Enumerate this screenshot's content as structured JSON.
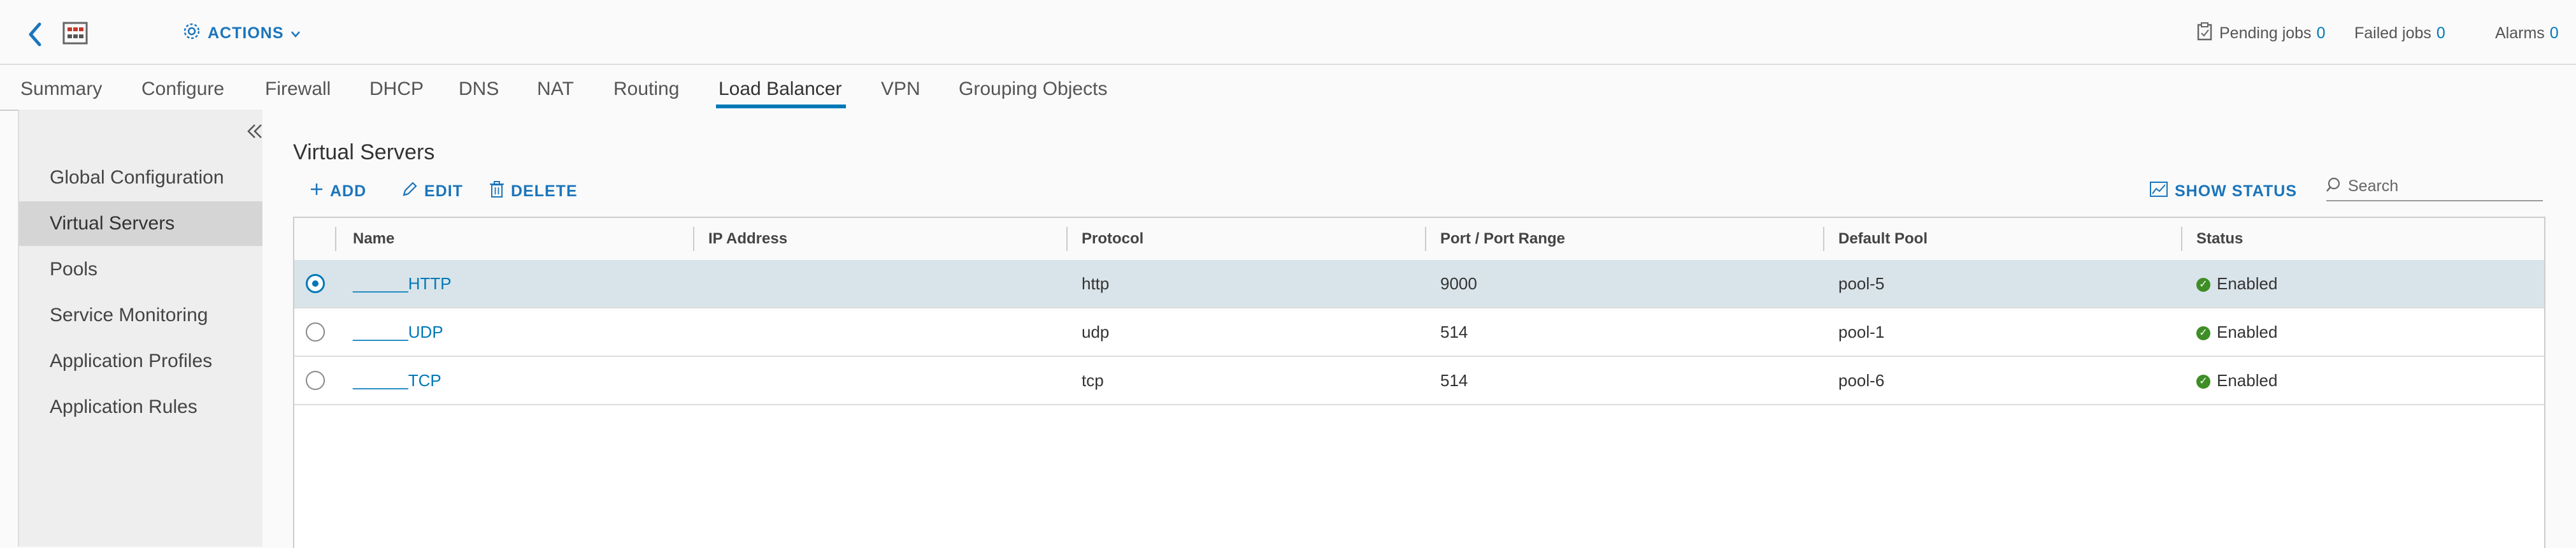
{
  "header": {
    "actions_label": "ACTIONS",
    "pending_jobs_label": "Pending jobs",
    "pending_jobs_count": "0",
    "failed_jobs_label": "Failed jobs",
    "failed_jobs_count": "0",
    "alarms_label": "Alarms",
    "alarms_count": "0"
  },
  "tabs": [
    {
      "label": "Summary"
    },
    {
      "label": "Configure"
    },
    {
      "label": "Firewall"
    },
    {
      "label": "DHCP"
    },
    {
      "label": "DNS"
    },
    {
      "label": "NAT"
    },
    {
      "label": "Routing"
    },
    {
      "label": "Load Balancer",
      "active": true
    },
    {
      "label": "VPN"
    },
    {
      "label": "Grouping Objects"
    }
  ],
  "sidebar": {
    "items": [
      {
        "label": "Global Configuration"
      },
      {
        "label": "Virtual Servers",
        "active": true
      },
      {
        "label": "Pools"
      },
      {
        "label": "Service Monitoring"
      },
      {
        "label": "Application Profiles"
      },
      {
        "label": "Application Rules"
      }
    ]
  },
  "main": {
    "title": "Virtual Servers",
    "toolbar": {
      "add_label": "ADD",
      "edit_label": "EDIT",
      "delete_label": "DELETE",
      "show_status_label": "SHOW STATUS"
    },
    "search": {
      "placeholder": "Search",
      "value": ""
    }
  },
  "table": {
    "columns": [
      "Name",
      "IP Address",
      "Protocol",
      "Port / Port Range",
      "Default Pool",
      "Status"
    ],
    "rows": [
      {
        "name": "______HTTP",
        "ip": "",
        "protocol": "http",
        "port": "9000",
        "pool": "pool-5",
        "status": "Enabled",
        "selected": true
      },
      {
        "name": "______UDP",
        "ip": "",
        "protocol": "udp",
        "port": "514",
        "pool": "pool-1",
        "status": "Enabled",
        "selected": false
      },
      {
        "name": "______TCP",
        "ip": "",
        "protocol": "tcp",
        "port": "514",
        "pool": "pool-6",
        "status": "Enabled",
        "selected": false
      }
    ]
  },
  "colors": {
    "accent": "#0079b8",
    "status_ok": "#3e8e25",
    "selected_row": "#d9e4ea"
  }
}
